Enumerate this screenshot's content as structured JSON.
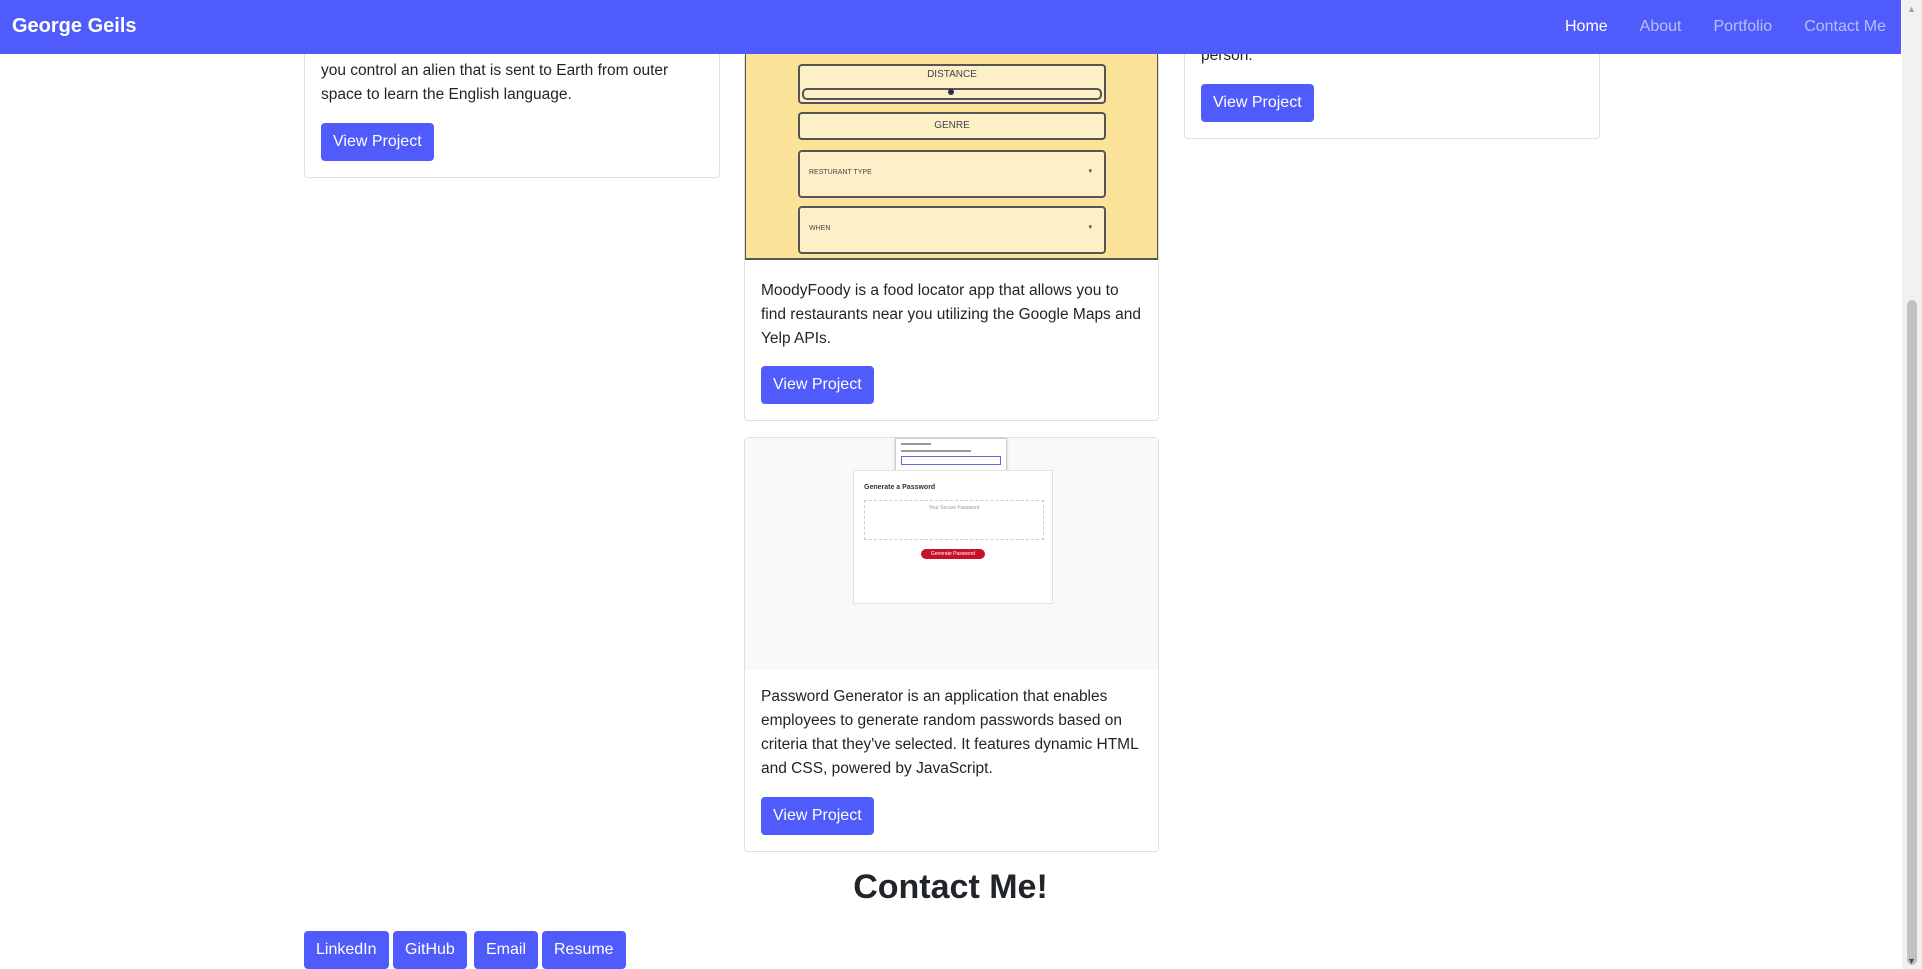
{
  "nav": {
    "brand": "George Geils",
    "links": [
      "Home",
      "About",
      "Portfolio",
      "Contact Me"
    ]
  },
  "cards": {
    "left": {
      "text_line1": "you control an alien that is sent to Earth from outer",
      "text_line2": "space to learn the English language.",
      "button": "View Project"
    },
    "right": {
      "text_fragment": "person.",
      "button": "View Project"
    },
    "moody": {
      "image_labels": {
        "distance": "DISTANCE",
        "genre": "GENRE",
        "restaurant_type": "RESTURANT TYPE",
        "when": "WHEN"
      },
      "text": "MoodyFoody is a food locator app that allows you to find restaurants near you utilizing the Google Maps and Yelp APIs.",
      "button": "View Project"
    },
    "password": {
      "image_labels": {
        "title": "Generate a Password",
        "placeholder": "Your Secure Password",
        "generate_button": "Generate Password"
      },
      "text": "Password Generator is an application that enables employees to generate random passwords based on criteria that they've selected. It features dynamic HTML and CSS, powered by JavaScript.",
      "button": "View Project"
    }
  },
  "contact": {
    "title": "Contact Me!",
    "buttons": [
      "LinkedIn",
      "GitHub",
      "Email",
      "Resume"
    ]
  },
  "colors": {
    "primary": "#4f5bfa",
    "card_border": "#dfe0e3",
    "moody_bg": "#fbe39a"
  }
}
